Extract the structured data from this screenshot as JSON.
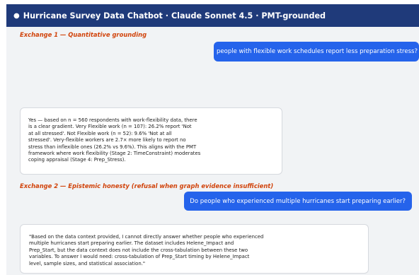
{
  "header": {
    "dot": "●",
    "title": "Hurricane Survey Data Chatbot · Claude Sonnet 4.5 · PMT-grounded"
  },
  "exchange1": {
    "label": "Exchange 1 — Quantitative grounding",
    "user_message": "people with flexible work schedules report less preparation stress?",
    "bot_lines": [
      "Yes — based on n = 560 respondents with work-flexibility data, there",
      "is a clear gradient. Very Flexible work (n = 107): 26.2% report 'Not",
      "at all stressed'. Not Flexible work (n = 52): 9.6% 'Not at all",
      "stressed'. Very-flexible workers are 2.7× more likely to report no",
      "stress than inflexible ones (26.2% vs 9.6%). This aligns with the PMT",
      "framework where work flexibility (Stage 2: TimeConstraint) moderates",
      "coping appraisal (Stage 4: Prep_Stress)."
    ]
  },
  "exchange2": {
    "label": "Exchange 2 — Epistemic honesty (refusal when graph evidence insufficient)",
    "user_message": "Do people who experienced multiple hurricanes start preparing earlier?",
    "bot_lines": [
      "\"Based on the data context provided, I cannot directly answer whether people who experienced",
      "multiple hurricanes start preparing earlier. The dataset includes Helene_Impact and",
      "Prep_Start, but the data context does not include the cross-tabulation between these two",
      "variables. To answer I would need: cross-tabulation of Prep_Start timing by Helene_Impact",
      "level, sample sizes, and statistical association.\""
    ]
  }
}
